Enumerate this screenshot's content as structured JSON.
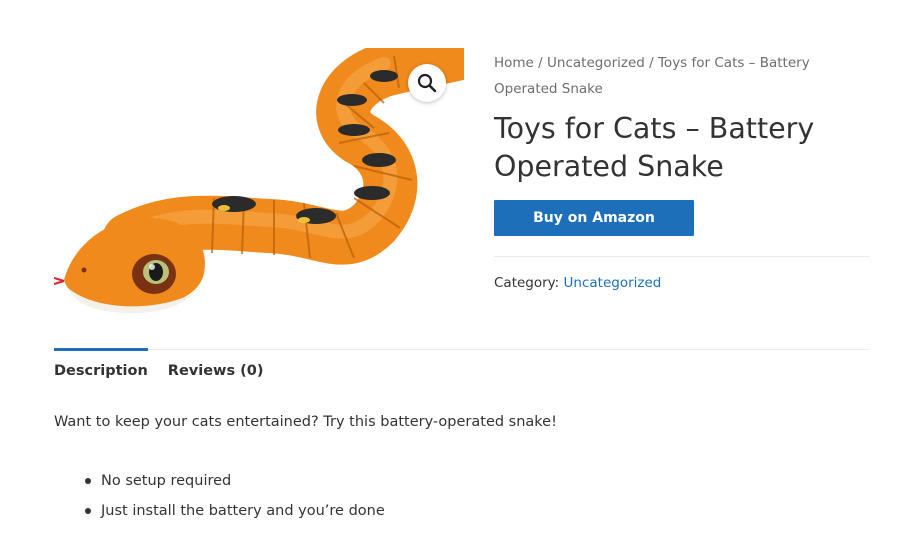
{
  "breadcrumb": {
    "home": "Home",
    "sep1": " / ",
    "category": "Uncategorized",
    "sep2": " / ",
    "current": "Toys for Cats – Battery Operated Snake"
  },
  "product": {
    "title": "Toys for Cats – Battery Operated Snake",
    "buy_label": "Buy on Amazon",
    "category_label": "Category: ",
    "category_value": "Uncategorized",
    "image_icon": "snake-toy-image",
    "zoom_icon": "magnifier-icon"
  },
  "tabs": [
    {
      "label": "Description",
      "active": true
    },
    {
      "label": "Reviews (0)",
      "active": false
    }
  ],
  "description": {
    "text": "Want to keep your cats entertained? Try this battery-operated snake!",
    "features": [
      "No setup required",
      "Just install the battery and you’re done"
    ]
  },
  "colors": {
    "accent": "#1e6fb9",
    "snake_orange": "#f08a1c",
    "snake_dark": "#2b2b2b"
  }
}
